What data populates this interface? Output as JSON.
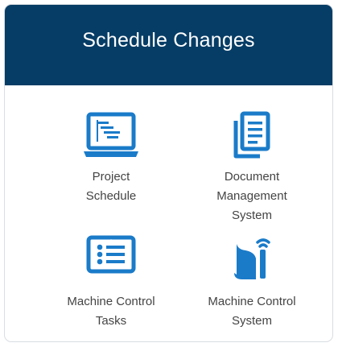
{
  "header": {
    "title": "Schedule Changes",
    "background": "#063d66"
  },
  "items": [
    {
      "label": "Project\nSchedule",
      "icon": "laptop-gantt-icon"
    },
    {
      "label": "Document\nManagement\nSystem",
      "icon": "documents-icon"
    },
    {
      "label": "Machine Control\nTasks",
      "icon": "task-list-tablet-icon"
    },
    {
      "label": "Machine Control\nSystem",
      "icon": "machine-control-device-icon"
    }
  ],
  "colors": {
    "icon": "#1a7bc9",
    "text": "#444444"
  }
}
